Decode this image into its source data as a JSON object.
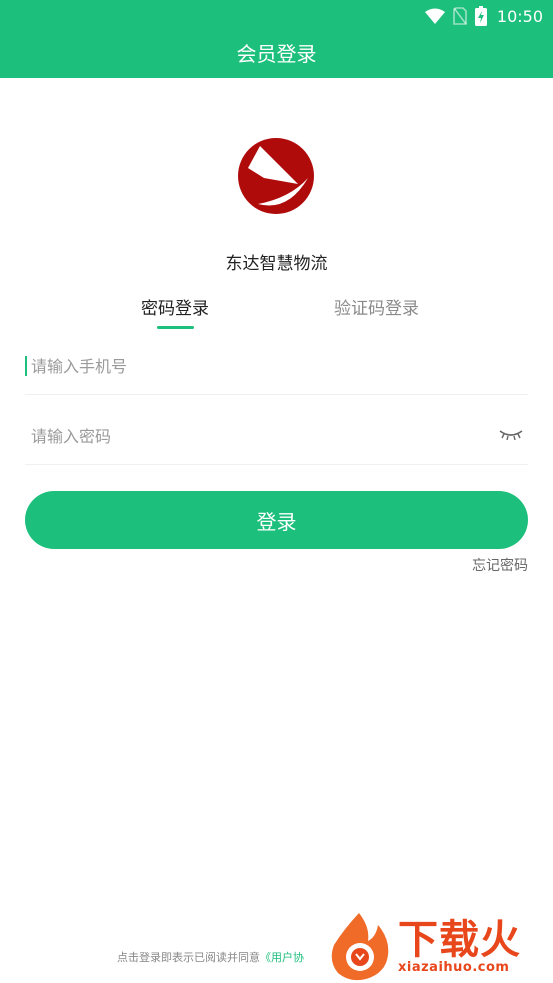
{
  "status_bar": {
    "time": "10:50"
  },
  "header": {
    "title": "会员登录"
  },
  "brand": {
    "name": "东达智慧物流"
  },
  "tabs": [
    {
      "label": "密码登录",
      "active": true
    },
    {
      "label": "验证码登录",
      "active": false
    }
  ],
  "form": {
    "phone": {
      "placeholder": "请输入手机号",
      "value": ""
    },
    "password": {
      "placeholder": "请输入密码",
      "value": ""
    },
    "password_visibility_icon": "eye-closed-icon",
    "login_label": "登录",
    "forgot_label": "忘记密码"
  },
  "agreement": {
    "text": "点击登录即表示已阅读并同意",
    "link": "《用户协"
  },
  "watermark": {
    "title": "下载火",
    "subtitle": "xiazaihuo.com"
  },
  "colors": {
    "accent": "#1dbf7c",
    "logo_red": "#b00b0b",
    "watermark_orange": "#e8471c"
  }
}
